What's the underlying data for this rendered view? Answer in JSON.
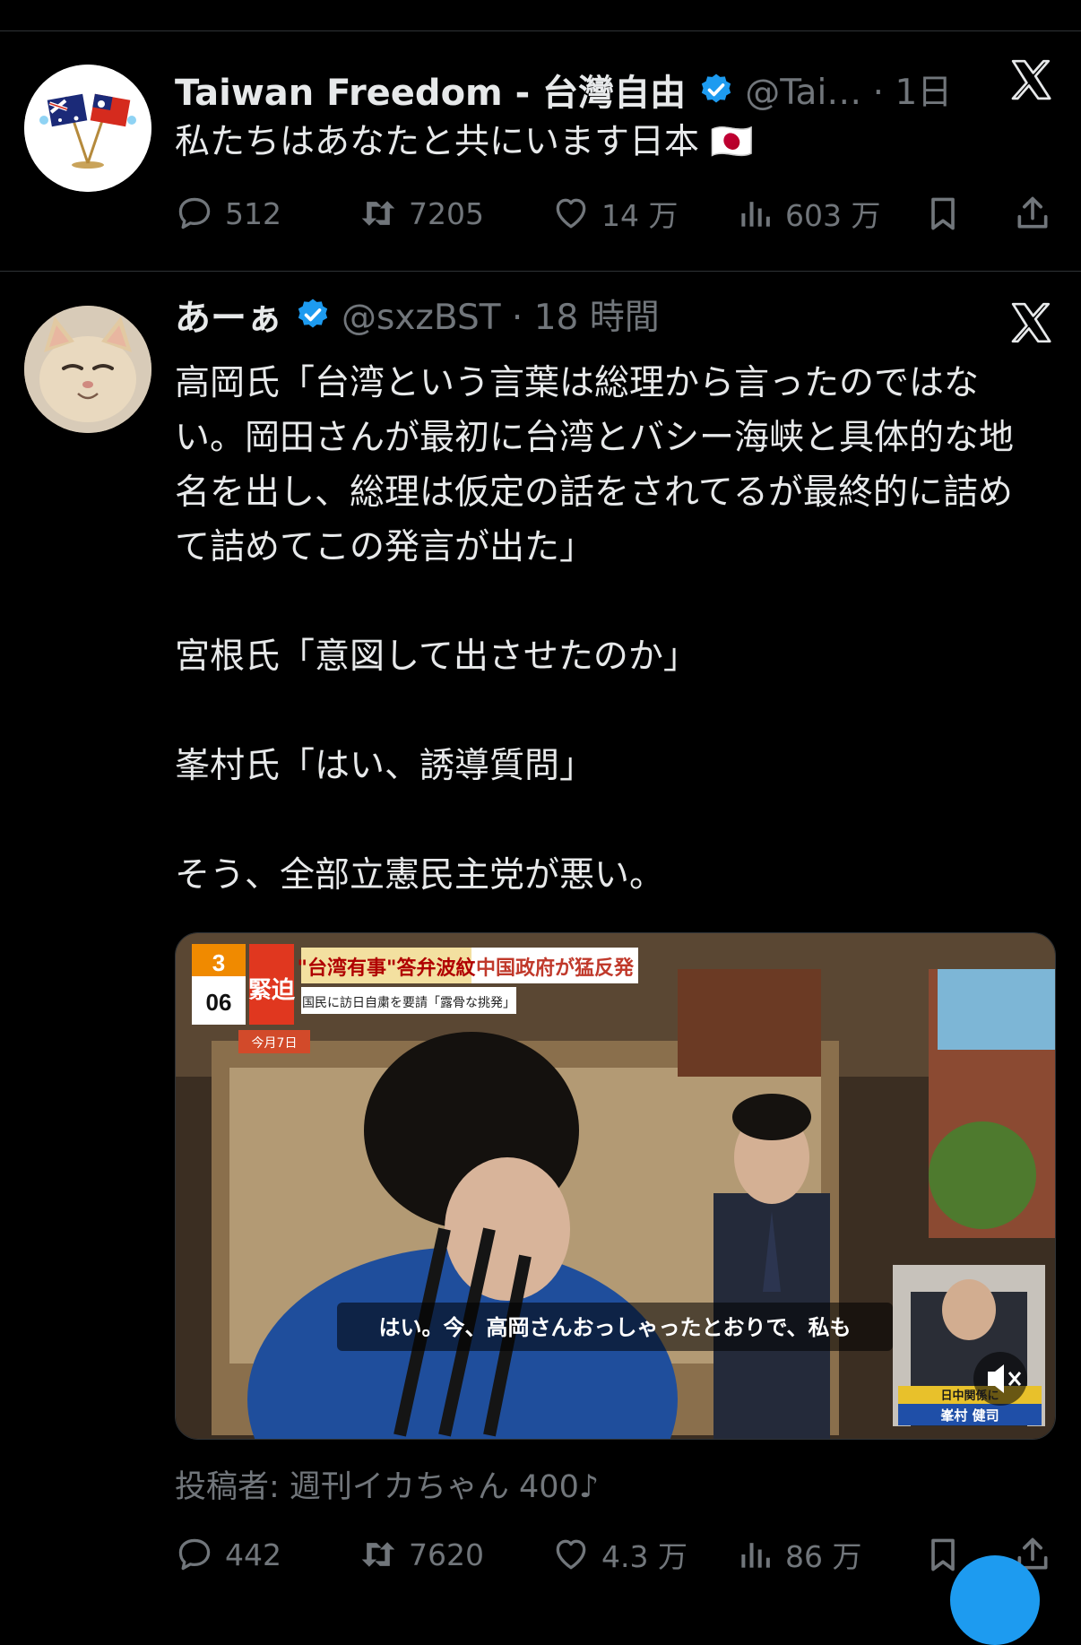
{
  "tweet1": {
    "name": "Taiwan Freedom - 台灣自由",
    "handle": "@Tai… · 1日",
    "text": "私たちはあなたと共にいます日本 🇯🇵",
    "stats": {
      "replies": "512",
      "reposts": "7205",
      "likes": "14 万",
      "views": "603 万"
    }
  },
  "tweet2": {
    "name": "あーぁ",
    "handle": "@sxzBST · 18 時間",
    "text": "高岡氏「台湾という言葉は総理から言ったのではない。岡田さんが最初に台湾とバシー海峡と具体的な地名を出し、総理は仮定の話をされてるが最終的に詰めて詰めてこの発言が出た」\n\n宮根氏「意図して出させたのか」\n\n峯村氏「はい、誘導質問」\n\nそう、全部立憲民主党が悪い。",
    "video": {
      "chip_number": "3",
      "chip_time": "06",
      "badge": "緊迫",
      "headline": "\"台湾有事\"答弁波紋",
      "headline_right": "中国政府が猛反発",
      "subheadline": "国民に訪日自粛を要請「露骨な挑発」",
      "date_tag": "今月7日",
      "subtitle": "はい。今、高岡さんおっしゃったとおりで、私も",
      "pip_label": "日中関係に",
      "pip_name": "峯村 健司"
    },
    "credit": "投稿者: 週刊イカちゃん 400♪",
    "stats": {
      "replies": "442",
      "reposts": "7620",
      "likes": "4.3 万",
      "views": "86 万"
    }
  }
}
